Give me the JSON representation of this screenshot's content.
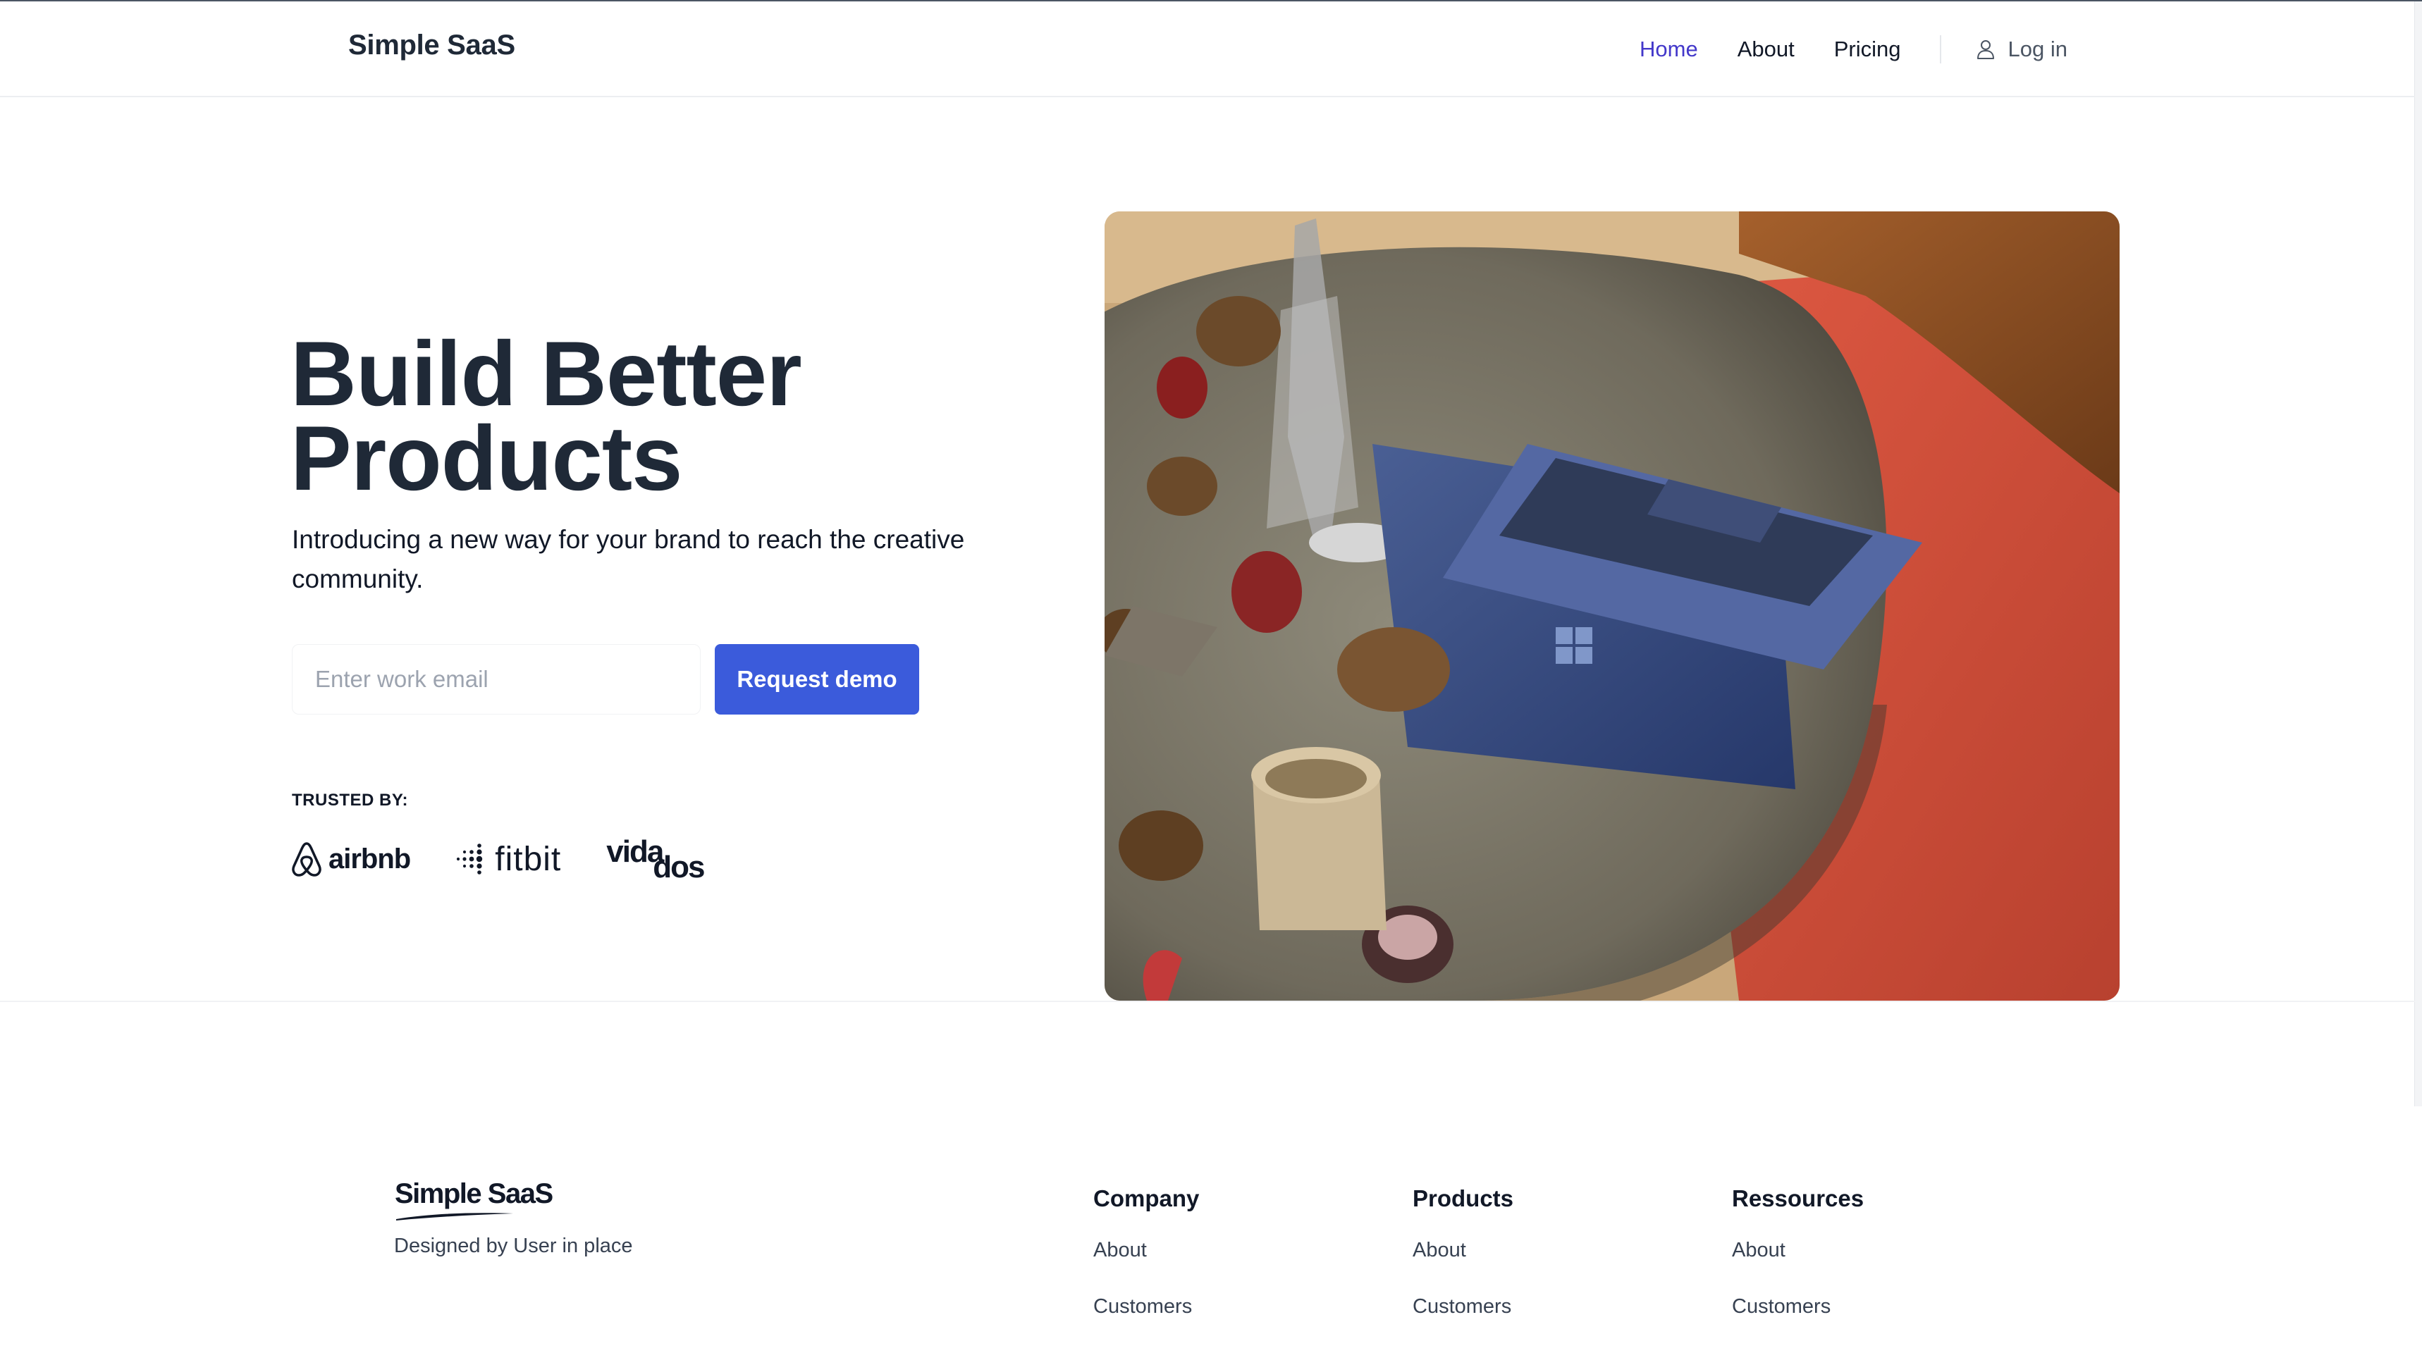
{
  "header": {
    "brand": "Simple SaaS",
    "nav": {
      "home": "Home",
      "about": "About",
      "pricing": "Pricing",
      "login": "Log in"
    },
    "active_color": "#4338ca"
  },
  "hero": {
    "title_line1": "Build Better",
    "title_line2": "Products",
    "subtitle": "Introducing a new way for your brand to reach the creative community.",
    "email_placeholder": "Enter work email",
    "email_value": "",
    "cta_label": "Request demo",
    "cta_color": "#3b5bdb",
    "trusted_label": "TRUSTED BY:",
    "logos": {
      "airbnb": "airbnb",
      "fitbit": "fitbit",
      "vidados_part1": "vida",
      "vidados_part2": "dos"
    },
    "image_icon": "laptop-on-table-photo"
  },
  "footer": {
    "logo_text": "Simple SaaS",
    "tagline": "Designed by User in place",
    "columns": [
      {
        "heading": "Company",
        "links": [
          "About",
          "Customers"
        ]
      },
      {
        "heading": "Products",
        "links": [
          "About",
          "Customers"
        ]
      },
      {
        "heading": "Ressources",
        "links": [
          "About",
          "Customers"
        ]
      }
    ]
  }
}
